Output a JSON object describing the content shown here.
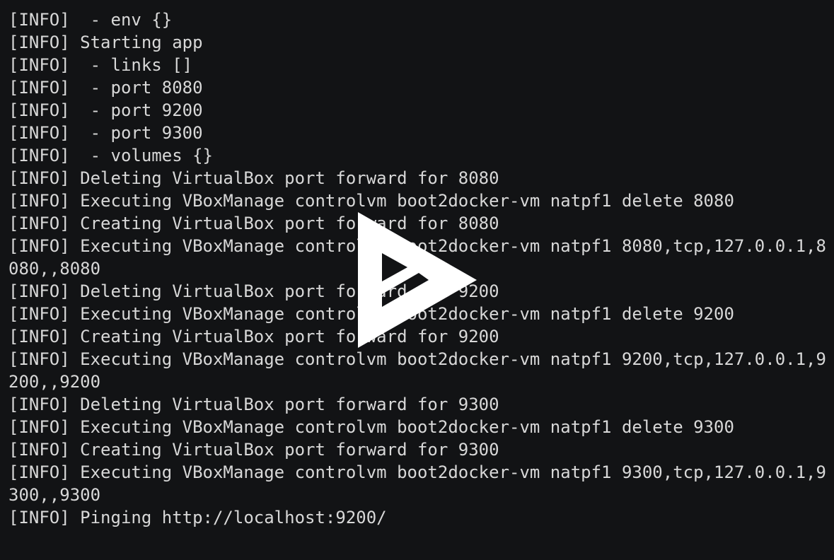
{
  "terminal": {
    "lines": [
      "[INFO]  - env {}",
      "[INFO] Starting app",
      "[INFO]  - links []",
      "[INFO]  - port 8080",
      "[INFO]  - port 9200",
      "[INFO]  - port 9300",
      "[INFO]  - volumes {}",
      "[INFO] Deleting VirtualBox port forward for 8080",
      "[INFO] Executing VBoxManage controlvm boot2docker-vm natpf1 delete 8080",
      "[INFO] Creating VirtualBox port forward for 8080",
      "[INFO] Executing VBoxManage controlvm boot2docker-vm natpf1 8080,tcp,127.0.0.1,8",
      "080,,8080",
      "[INFO] Deleting VirtualBox port forward for 9200",
      "[INFO] Executing VBoxManage controlvm boot2docker-vm natpf1 delete 9200",
      "[INFO] Creating VirtualBox port forward for 9200",
      "[INFO] Executing VBoxManage controlvm boot2docker-vm natpf1 9200,tcp,127.0.0.1,9",
      "200,,9200",
      "[INFO] Deleting VirtualBox port forward for 9300",
      "[INFO] Executing VBoxManage controlvm boot2docker-vm natpf1 delete 9300",
      "[INFO] Creating VirtualBox port forward for 9300",
      "[INFO] Executing VBoxManage controlvm boot2docker-vm natpf1 9300,tcp,127.0.0.1,9",
      "300,,9300",
      "[INFO] Pinging http://localhost:9200/"
    ]
  },
  "overlay": {
    "icon": "play-icon",
    "color": "#ffffff"
  },
  "colors": {
    "background": "#121315",
    "text": "#d8d8d8"
  }
}
